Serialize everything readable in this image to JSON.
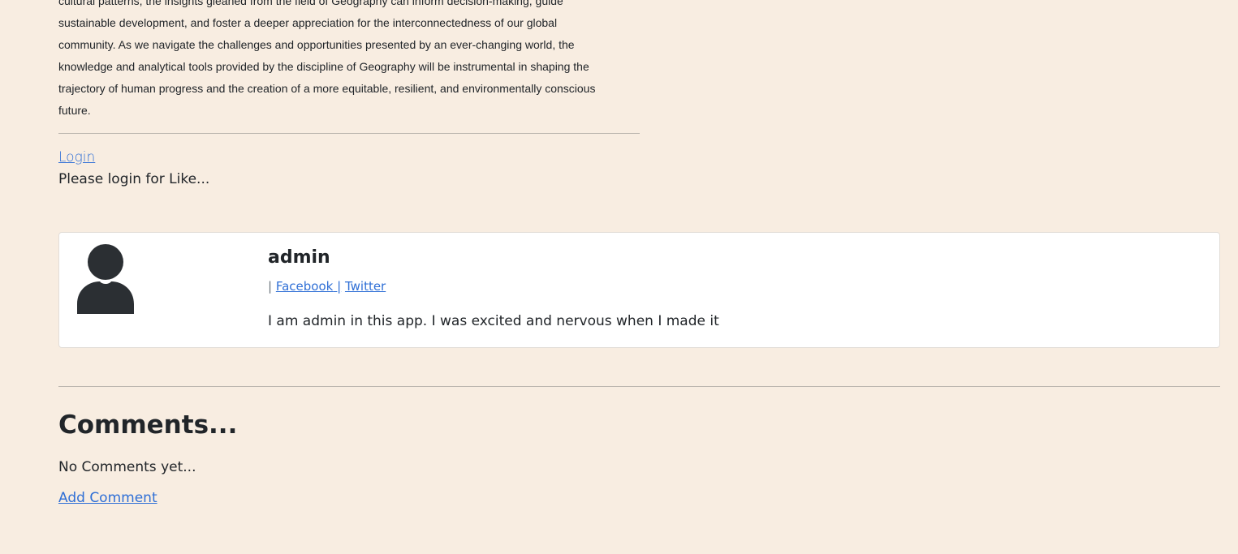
{
  "article": {
    "lines": [
      "cultural patterns, the insights gleaned from the field of Geography can inform decision-making, guide",
      "sustainable development, and foster a deeper appreciation for the interconnectedness of our global",
      "community. As we navigate the challenges and opportunities presented by an ever-changing world, the",
      "knowledge and analytical tools provided by the discipline of Geography will be instrumental in shaping the",
      "trajectory of human progress and the creation of a more equitable, resilient, and environmentally conscious",
      "future."
    ]
  },
  "like": {
    "login_label": "Login",
    "note": "Please login for Like..."
  },
  "author": {
    "avatar_icon": "person-icon",
    "name": "admin",
    "separator": "|",
    "facebook_label": "Facebook",
    "twitter_label": "Twitter",
    "bio": "I am admin in this app. I was excited and nervous when I made it"
  },
  "comments": {
    "title": "Comments...",
    "empty_text": "No Comments yet...",
    "add_label": "Add Comment"
  },
  "colors": {
    "background": "#f8ede1",
    "link": "#2f6fd6",
    "avatar": "#2b2f33"
  }
}
